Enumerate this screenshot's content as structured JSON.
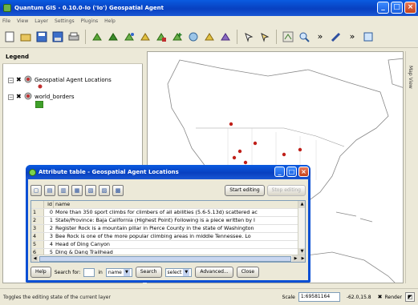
{
  "window": {
    "title": "Quantum GIS - 0.10.0-Io ('Io') Geospatial Agent"
  },
  "menu": [
    "File",
    "View",
    "Layer",
    "Settings",
    "Plugins",
    "Help"
  ],
  "toolbar": {
    "icons": [
      "new-project-icon",
      "open-project-icon",
      "save-project-icon",
      "save-as-icon",
      "print-icon",
      "add-vector-layer-icon",
      "add-raster-layer-icon",
      "add-postgis-layer-icon",
      "new-vector-layer-icon",
      "remove-layer-icon",
      "add-all-icon",
      "remove-all-icon",
      "overview-icon",
      "hide-all-icon",
      "identify-icon",
      "help-icon",
      "zoom-full-icon",
      "zoom-in-icon",
      "more-icon",
      "pencil-icon",
      "more-icon-2",
      "plugin-icon"
    ]
  },
  "legend": {
    "title": "Legend",
    "layers": [
      {
        "name": "Geospatial Agent Locations",
        "checked": true,
        "symbol_color": "#c03030"
      },
      {
        "name": "world_borders",
        "checked": true,
        "symbol_color": "#3fa02a"
      }
    ]
  },
  "map": {
    "side_tab": "Map View",
    "land_color": "#ffffff",
    "border_color": "#888888",
    "point_color": "#c0201a"
  },
  "attribute_table": {
    "title": "Attribute table - Geospatial Agent Locations",
    "start_editing": "Start editing",
    "stop_editing": "Stop editing",
    "columns": [
      "id",
      "name"
    ],
    "rows": [
      {
        "row": "1",
        "id": "0",
        "name": "More than 350 sport climbs for climbers of all abilities (5.6-5.13d) scattered ac"
      },
      {
        "row": "2",
        "id": "1",
        "name": "State/Province: Baja California (Highest Point) Following is a piece written by I"
      },
      {
        "row": "3",
        "id": "2",
        "name": "Register Rock is a mountain pillar in Pierce County in the state of Washington"
      },
      {
        "row": "4",
        "id": "3",
        "name": "Bee Rock is one of the more popular climbing areas in middle Tennessee. Lo"
      },
      {
        "row": "5",
        "id": "4",
        "name": "Head of Ding Canyon"
      },
      {
        "row": "6",
        "id": "5",
        "name": "Ding & Dang Trailhead"
      }
    ],
    "bottom": {
      "help": "Help",
      "search_for": "Search for:",
      "in": "in",
      "field_select": "name",
      "search": "Search",
      "select_combo": "select",
      "advanced": "Advanced...",
      "close": "Close"
    }
  },
  "status": {
    "message": "Toggles the editing state of the current layer",
    "scale_label": "Scale",
    "scale_value": "1:69581164",
    "coords": "-62.0,15.8",
    "render_label": "Render"
  }
}
